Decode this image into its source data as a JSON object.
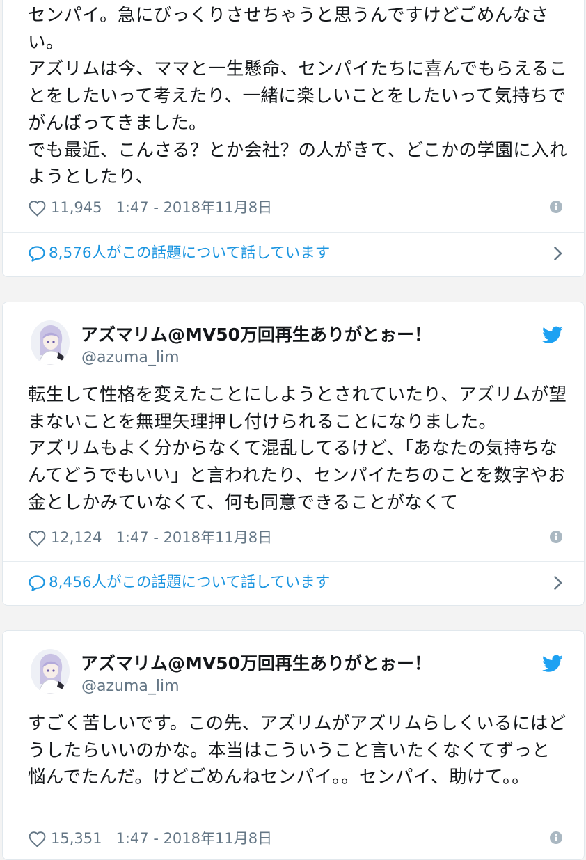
{
  "colors": {
    "accent": "#1da1f2",
    "link": "#1b95e0",
    "muted": "#657786",
    "text": "#14171a",
    "info": "#aab8c2"
  },
  "icons": {
    "like": "heart-icon",
    "info": "info-icon",
    "reply": "speech-bubble-icon",
    "brand": "twitter-bird-icon",
    "more": "chevron-right-icon"
  },
  "tweets": [
    {
      "text": "センパイ。急にびっくりさせちゃうと思うんですけどごめんなさい。\nアズリムは今、ママと一生懸命、センパイたちに喜んでもらえることをしたいって考えたり、一緒に楽しいことをしたいって気持ちでがんばってきました。\nでも最近、こんさる？とか会社？の人がきて、どこかの学園に入れようとしたり、",
      "likes": "11,945",
      "timestamp": "1:47 - 2018年11月8日",
      "conversation": "8,576人がこの話題について話しています"
    },
    {
      "author": "アズマリム@MV50万回再生ありがとぉー！",
      "handle": "@azuma_lim",
      "text": "転生して性格を変えたことにしようとされていたり、アズリムが望まないことを無理矢理押し付けられることになりました。\nアズリムもよく分からなくて混乱してるけど、「あなたの気持ちなんてどうでもいい」と言われたり、センパイたちのことを数字やお金としかみていなくて、何も同意できることがなくて",
      "likes": "12,124",
      "timestamp": "1:47 - 2018年11月8日",
      "conversation": "8,456人がこの話題について話しています"
    },
    {
      "author": "アズマリム@MV50万回再生ありがとぉー！",
      "handle": "@azuma_lim",
      "text": "すごく苦しいです。この先、アズリムがアズリムらしくいるにはどうしたらいいのかな。本当はこういうこと言いたくなくてずっと悩んでたんだ。けどごめんねセンパイ。。センパイ、助けて。。",
      "likes": "15,351",
      "timestamp": "1:47 - 2018年11月8日"
    }
  ]
}
